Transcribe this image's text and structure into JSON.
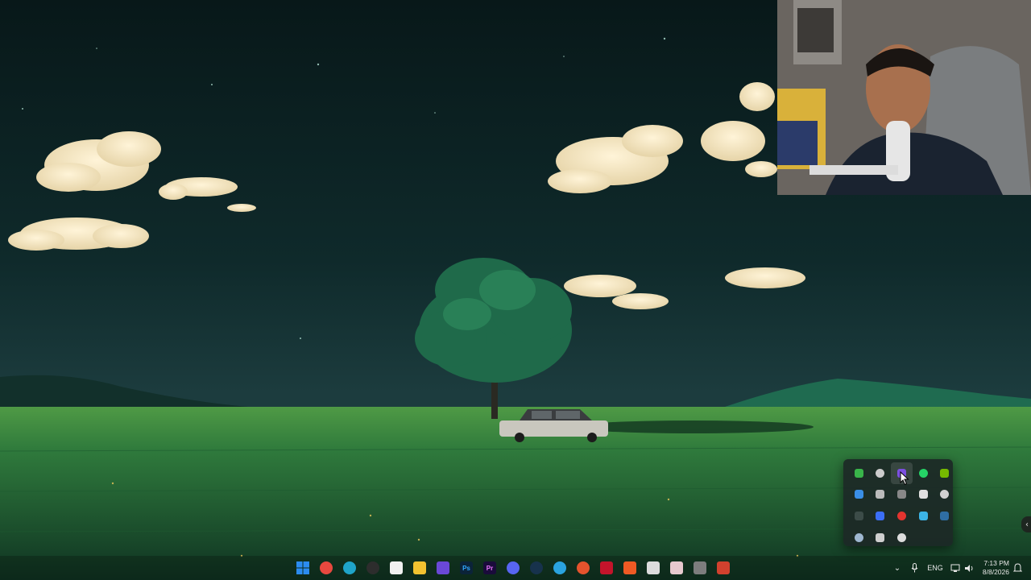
{
  "taskbar": {
    "pinned": [
      {
        "name": "start-button",
        "icon": "windows-logo-icon",
        "glyph": "",
        "color": "#2b8cf0"
      },
      {
        "name": "chrome-app",
        "icon": "chrome-icon",
        "glyph": "",
        "color": "#e8483f"
      },
      {
        "name": "edge-app",
        "icon": "edge-icon",
        "glyph": "",
        "color": "#1fa4c9"
      },
      {
        "name": "obs-app",
        "icon": "obs-icon",
        "glyph": "",
        "color": "#2d2d2d"
      },
      {
        "name": "store-app",
        "icon": "store-icon",
        "glyph": "",
        "color": "#f0f0f0"
      },
      {
        "name": "file-explorer-app",
        "icon": "folder-icon",
        "glyph": "",
        "color": "#f2c230"
      },
      {
        "name": "media-player-app",
        "icon": "play-icon",
        "glyph": "",
        "color": "#6a48d7"
      },
      {
        "name": "photoshop-app",
        "icon": "photoshop-icon",
        "glyph": "Ps",
        "color": "#0b2339"
      },
      {
        "name": "premiere-app",
        "icon": "premiere-icon",
        "glyph": "Pr",
        "color": "#1a0b3b"
      },
      {
        "name": "discord-app",
        "icon": "discord-icon",
        "glyph": "",
        "color": "#5865f2"
      },
      {
        "name": "steam-app",
        "icon": "steam-icon",
        "glyph": "",
        "color": "#17324c"
      },
      {
        "name": "telegram-app",
        "icon": "telegram-icon",
        "glyph": "",
        "color": "#2aa3df"
      },
      {
        "name": "app-orange",
        "icon": "orange-app-icon",
        "glyph": "",
        "color": "#e5532d"
      },
      {
        "name": "acrobat-app",
        "icon": "acrobat-icon",
        "glyph": "",
        "color": "#c3142b"
      },
      {
        "name": "brave-app",
        "icon": "brave-icon",
        "glyph": "",
        "color": "#f05a24"
      },
      {
        "name": "app-white",
        "icon": "app-icon",
        "glyph": "",
        "color": "#dcdcdc"
      },
      {
        "name": "app-pink",
        "icon": "app-icon",
        "glyph": "",
        "color": "#e7c9cf"
      },
      {
        "name": "app-gray",
        "icon": "app-icon",
        "glyph": "",
        "color": "#7d7d7d"
      },
      {
        "name": "brave-beta-app",
        "icon": "brave-icon",
        "glyph": "",
        "color": "#d2412e"
      }
    ],
    "tray": {
      "language": "ENG",
      "time": "7:13 PM",
      "date": "8/8/2026"
    }
  },
  "tray_flyout": {
    "icons": [
      {
        "name": "tray-green-app",
        "icon": "green-hex-icon",
        "color": "#39b54a"
      },
      {
        "name": "tray-obs",
        "icon": "obs-icon",
        "color": "#cccccc"
      },
      {
        "name": "tray-purple-app",
        "icon": "purple-app-icon",
        "color": "#7b4fe0"
      },
      {
        "name": "tray-whatsapp",
        "icon": "whatsapp-icon",
        "color": "#25d366"
      },
      {
        "name": "tray-nvidia",
        "icon": "nvidia-icon",
        "color": "#76b900"
      },
      {
        "name": "tray-grid-app",
        "icon": "grid-icon",
        "color": "#3a8ee6"
      },
      {
        "name": "tray-x-app",
        "icon": "x-icon",
        "color": "#bbbbbb"
      },
      {
        "name": "tray-dots-app",
        "icon": "dots-icon",
        "color": "#888888"
      },
      {
        "name": "tray-bold-app",
        "icon": "bold-b-icon",
        "color": "#e0e0e0"
      },
      {
        "name": "tray-chatgpt",
        "icon": "openai-icon",
        "color": "#d0d0d0"
      },
      {
        "name": "tray-dim-app",
        "icon": "app-icon",
        "color": "#3c4c48"
      },
      {
        "name": "tray-meta-app",
        "icon": "meta-icon",
        "color": "#3b6ef5"
      },
      {
        "name": "tray-steelseries",
        "icon": "steelseries-icon",
        "color": "#e3342f"
      },
      {
        "name": "tray-blue-app",
        "icon": "blue-app-icon",
        "color": "#3cb4e6"
      },
      {
        "name": "tray-dark-app",
        "icon": "app-icon",
        "color": "#2f6ea3"
      },
      {
        "name": "tray-steam",
        "icon": "steam-icon",
        "color": "#9fb7d0"
      },
      {
        "name": "tray-pin-app",
        "icon": "pin-icon",
        "color": "#cfcfcf"
      },
      {
        "name": "tray-shield-app",
        "icon": "shield-icon",
        "color": "#dddddd"
      }
    ]
  },
  "colors": {
    "sky_top": "#0a1c1f",
    "sky_horizon": "#1b3a3d",
    "grass": "#2f7a3c"
  }
}
